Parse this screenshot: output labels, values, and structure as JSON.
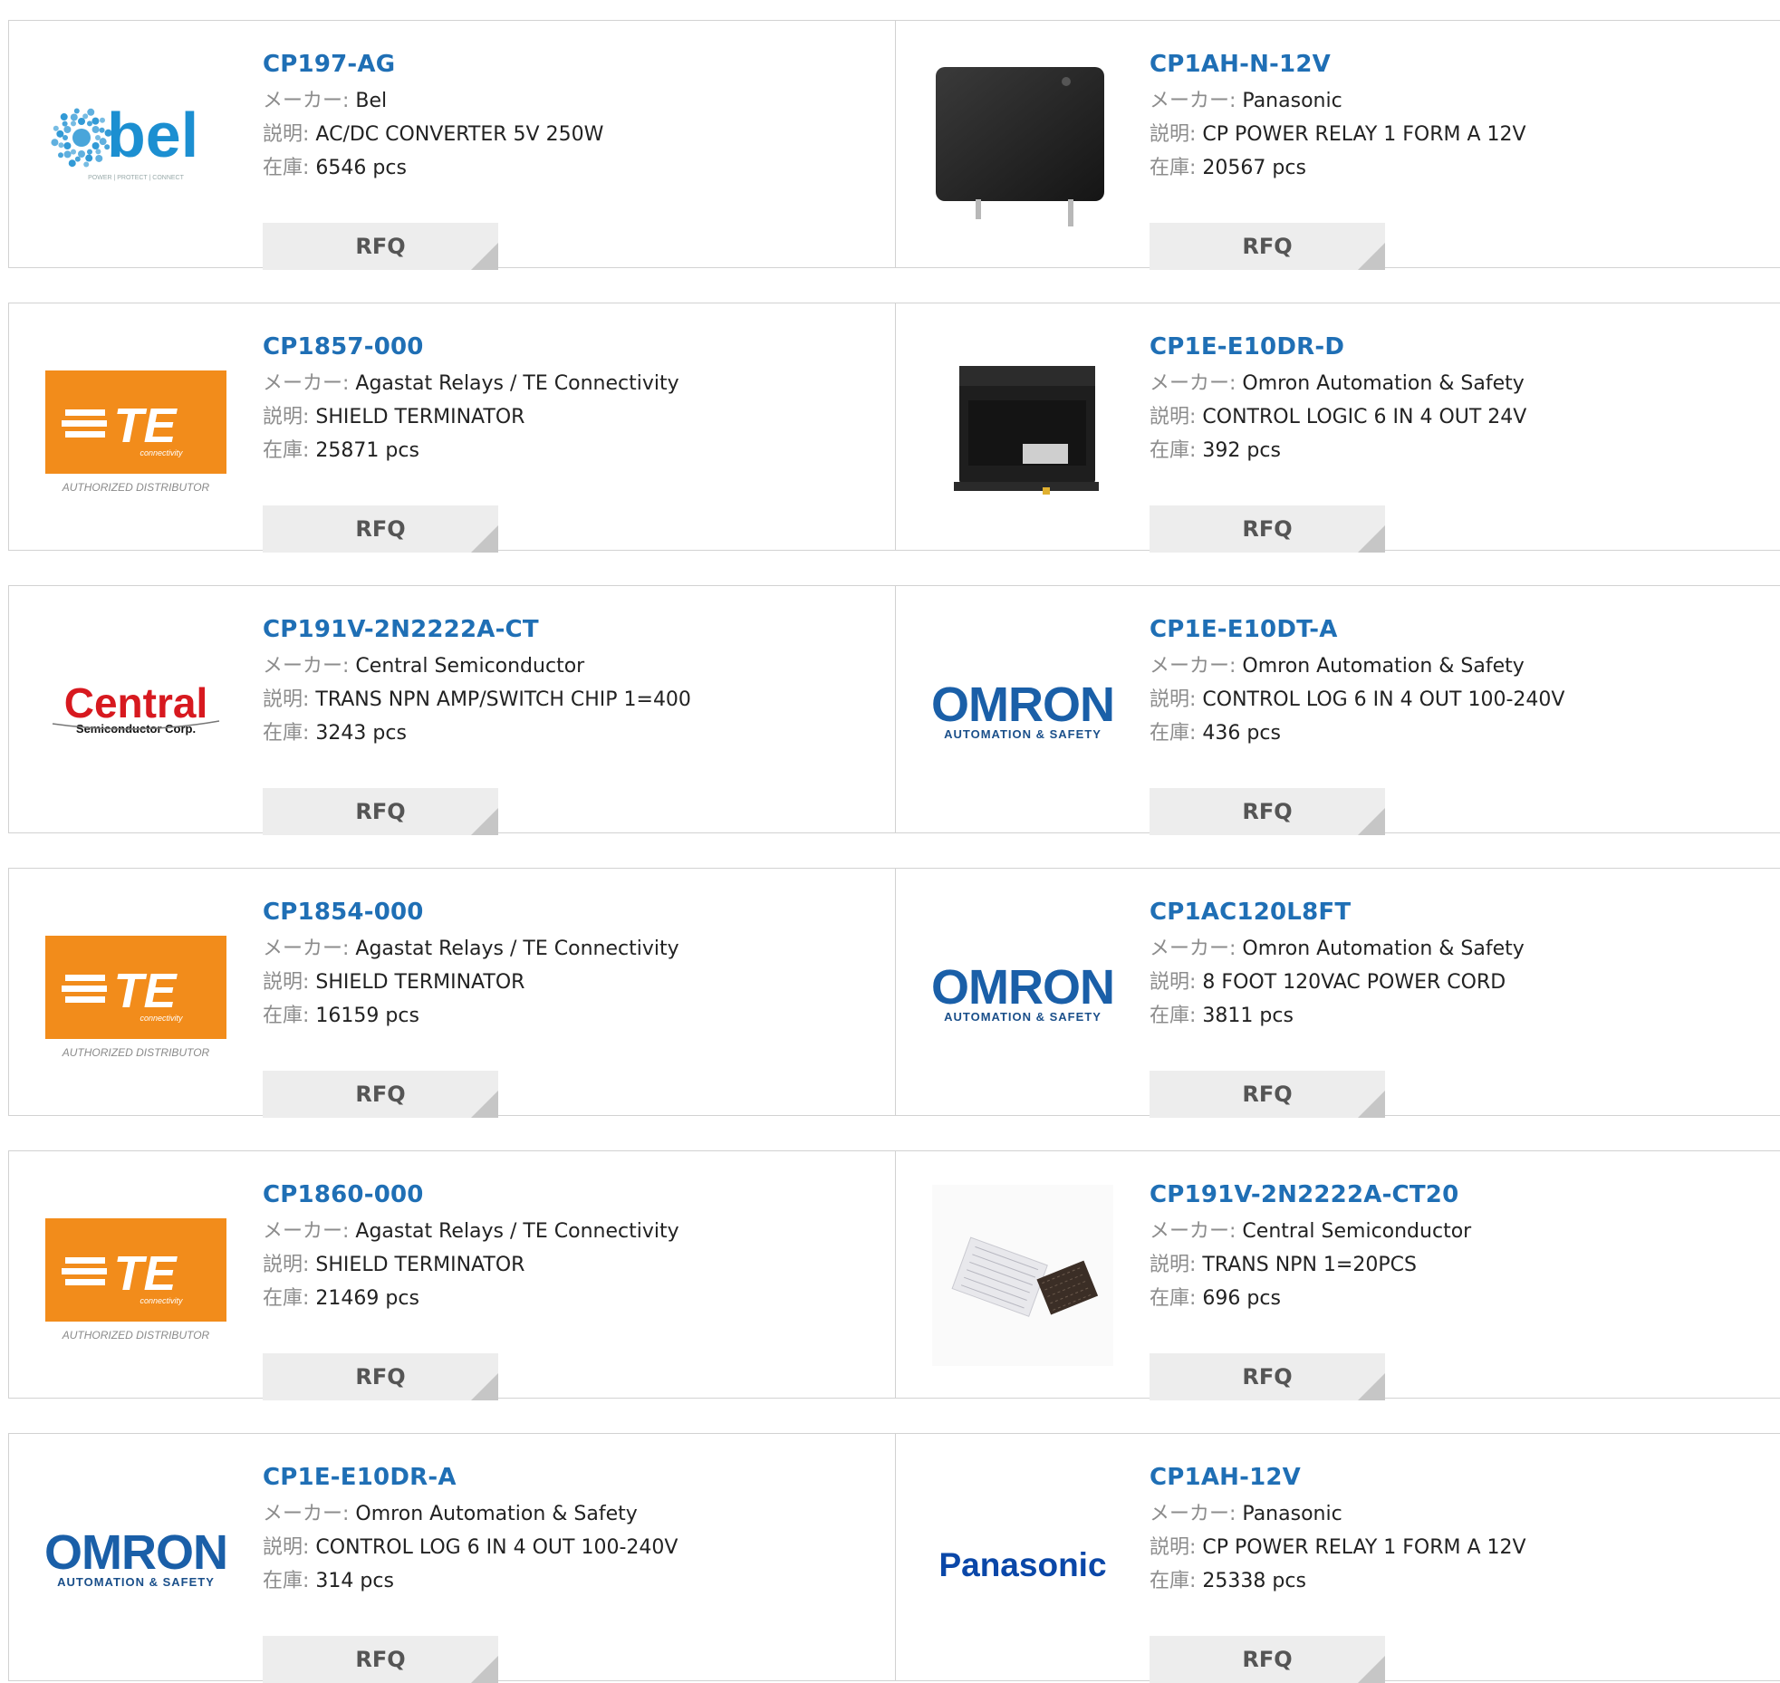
{
  "labels": {
    "maker": "メーカー:",
    "desc": "説明:",
    "stock": "在庫:",
    "rfq": "RFQ"
  },
  "rows": [
    {
      "left": {
        "part": "CP197-AG",
        "maker": "Bel",
        "desc": "AC/DC CONVERTER 5V 250W",
        "stock": "6546 pcs",
        "image": "bel-logo",
        "logo_text": "bel",
        "logo_sub": "POWER | PROTECT | CONNECT"
      },
      "right": {
        "part": "CP1AH-N-12V",
        "maker": "Panasonic",
        "desc": "CP POWER RELAY 1 FORM A 12V",
        "stock": "20567 pcs",
        "image": "relay-photo"
      }
    },
    {
      "left": {
        "part": "CP1857-000",
        "maker": "Agastat Relays / TE Connectivity",
        "desc": "SHIELD TERMINATOR",
        "stock": "25871 pcs",
        "image": "te-logo",
        "logo_text": "TE",
        "logo_sub": "connectivity",
        "logo_caption": "AUTHORIZED DISTRIBUTOR"
      },
      "right": {
        "part": "CP1E-E10DR-D",
        "maker": "Omron Automation & Safety",
        "desc": "CONTROL LOGIC 6 IN 4 OUT 24V",
        "stock": "392 pcs",
        "image": "plc-photo"
      }
    },
    {
      "left": {
        "part": "CP191V-2N2222A-CT",
        "maker": "Central Semiconductor",
        "desc": "TRANS NPN AMP/SWITCH CHIP 1=400",
        "stock": "3243 pcs",
        "image": "central-logo",
        "logo_text": "Central",
        "logo_sub": "Semiconductor Corp."
      },
      "right": {
        "part": "CP1E-E10DT-A",
        "maker": "Omron Automation & Safety",
        "desc": "CONTROL LOG 6 IN 4 OUT 100-240V",
        "stock": "436 pcs",
        "image": "omron-logo",
        "logo_text": "OMRON",
        "logo_sub": "AUTOMATION & SAFETY"
      }
    },
    {
      "left": {
        "part": "CP1854-000",
        "maker": "Agastat Relays / TE Connectivity",
        "desc": "SHIELD TERMINATOR",
        "stock": "16159 pcs",
        "image": "te-logo",
        "logo_text": "TE",
        "logo_sub": "connectivity",
        "logo_caption": "AUTHORIZED DISTRIBUTOR"
      },
      "right": {
        "part": "CP1AC120L8FT",
        "maker": "Omron Automation & Safety",
        "desc": "8 FOOT 120VAC POWER CORD",
        "stock": "3811 pcs",
        "image": "omron-logo",
        "logo_text": "OMRON",
        "logo_sub": "AUTOMATION & SAFETY"
      }
    },
    {
      "left": {
        "part": "CP1860-000",
        "maker": "Agastat Relays / TE Connectivity",
        "desc": "SHIELD TERMINATOR",
        "stock": "21469 pcs",
        "image": "te-logo",
        "logo_text": "TE",
        "logo_sub": "connectivity",
        "logo_caption": "AUTHORIZED DISTRIBUTOR"
      },
      "right": {
        "part": "CP191V-2N2222A-CT20",
        "maker": "Central Semiconductor",
        "desc": "TRANS NPN 1=20PCS",
        "stock": "696 pcs",
        "image": "chip-photo"
      }
    },
    {
      "left": {
        "part": "CP1E-E10DR-A",
        "maker": "Omron Automation & Safety",
        "desc": "CONTROL LOG 6 IN 4 OUT 100-240V",
        "stock": "314 pcs",
        "image": "omron-logo",
        "logo_text": "OMRON",
        "logo_sub": "AUTOMATION & SAFETY"
      },
      "right": {
        "part": "CP1AH-12V",
        "maker": "Panasonic",
        "desc": "CP POWER RELAY 1 FORM A 12V",
        "stock": "25338 pcs",
        "image": "panasonic-logo",
        "logo_text": "Panasonic"
      }
    }
  ],
  "colors": {
    "part_link": "#1f6fb5",
    "label_gray": "#8c8c8c",
    "border": "#d2d2d2",
    "rfq_bg": "#ededed",
    "te_orange": "#f28c1b",
    "bel_blue": "#1c8fd1",
    "omron_blue": "#1a5fa8",
    "central_red": "#d7191f",
    "panasonic_blue": "#0a47a8"
  }
}
